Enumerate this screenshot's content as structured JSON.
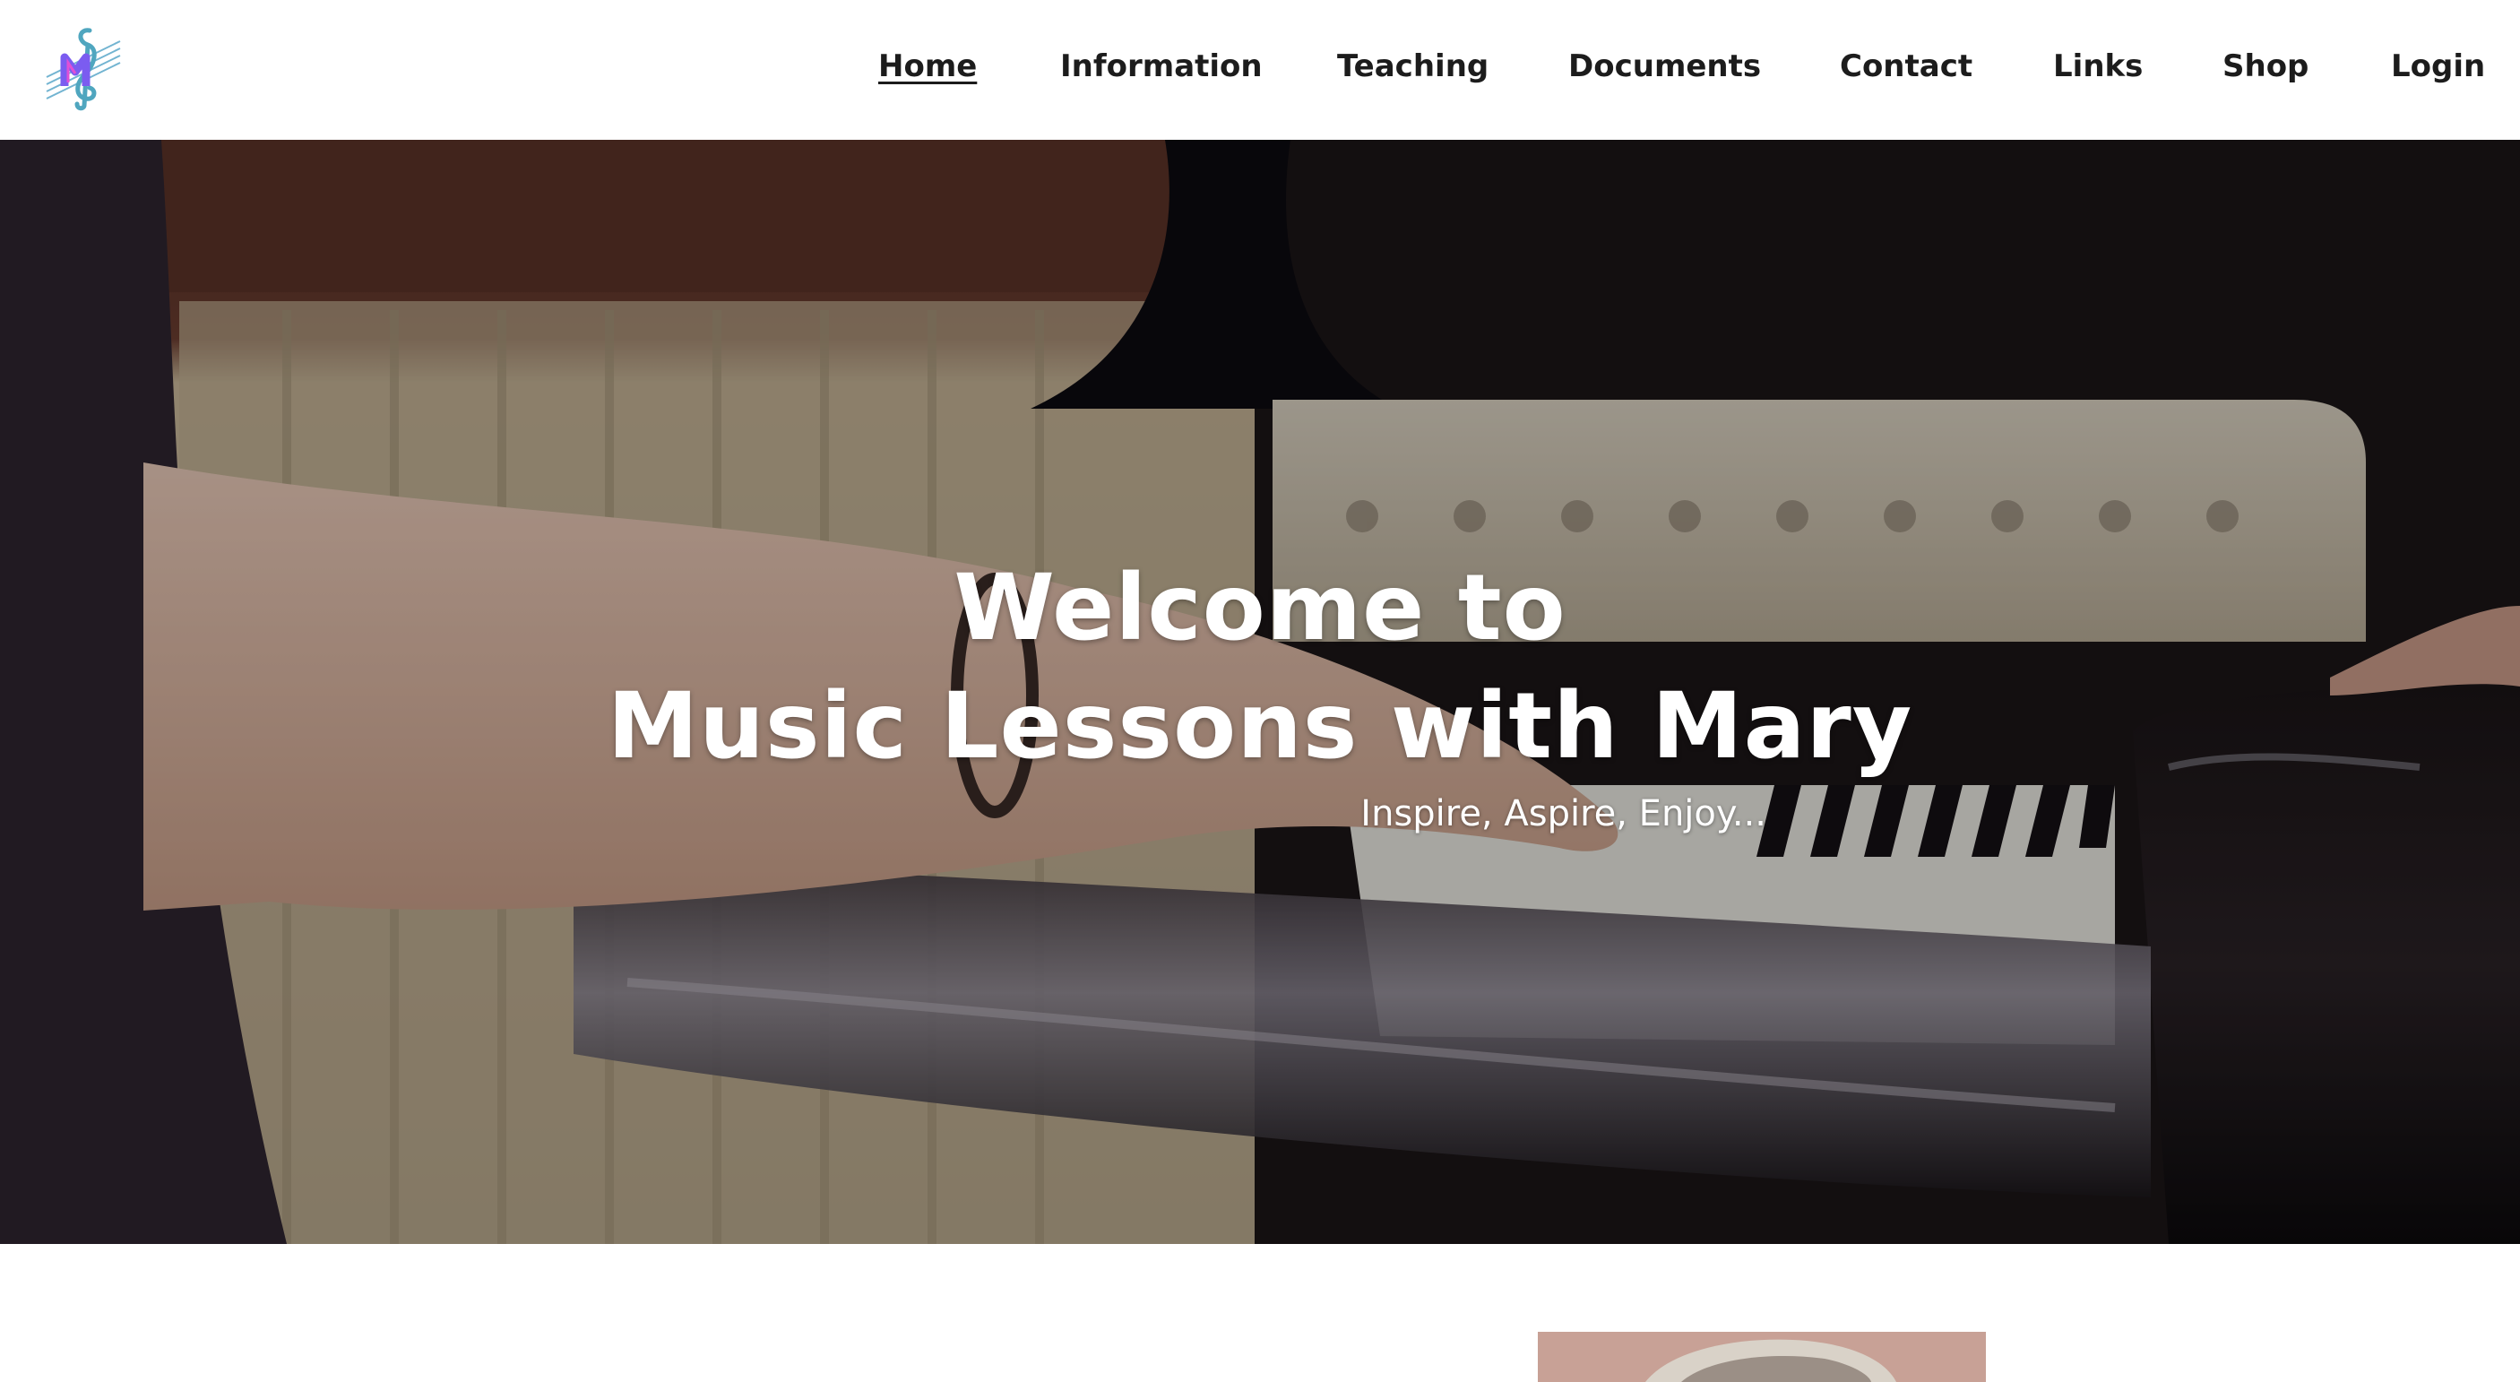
{
  "nav": {
    "items": [
      {
        "label": "Home",
        "active": true
      },
      {
        "label": "Information",
        "active": false
      },
      {
        "label": "Teaching",
        "active": false
      },
      {
        "label": "Documents",
        "active": false
      },
      {
        "label": "Contact",
        "active": false
      },
      {
        "label": "Links",
        "active": false
      },
      {
        "label": "Shop",
        "active": false
      },
      {
        "label": "Login",
        "active": false
      }
    ]
  },
  "logo": {
    "icon": "treble-clef-m-icon",
    "colors": [
      "#3aa3c9",
      "#7b5cf0",
      "#e04fd6"
    ]
  },
  "hero": {
    "title_line1": "Welcome to",
    "title_line2": "Music Lessons with Mary",
    "subtitle": "Inspire, Aspire, Enjoy..."
  },
  "colors": {
    "nav_text": "#1c1c1c",
    "hero_text": "#ffffff",
    "header_bg": "#ffffff"
  }
}
